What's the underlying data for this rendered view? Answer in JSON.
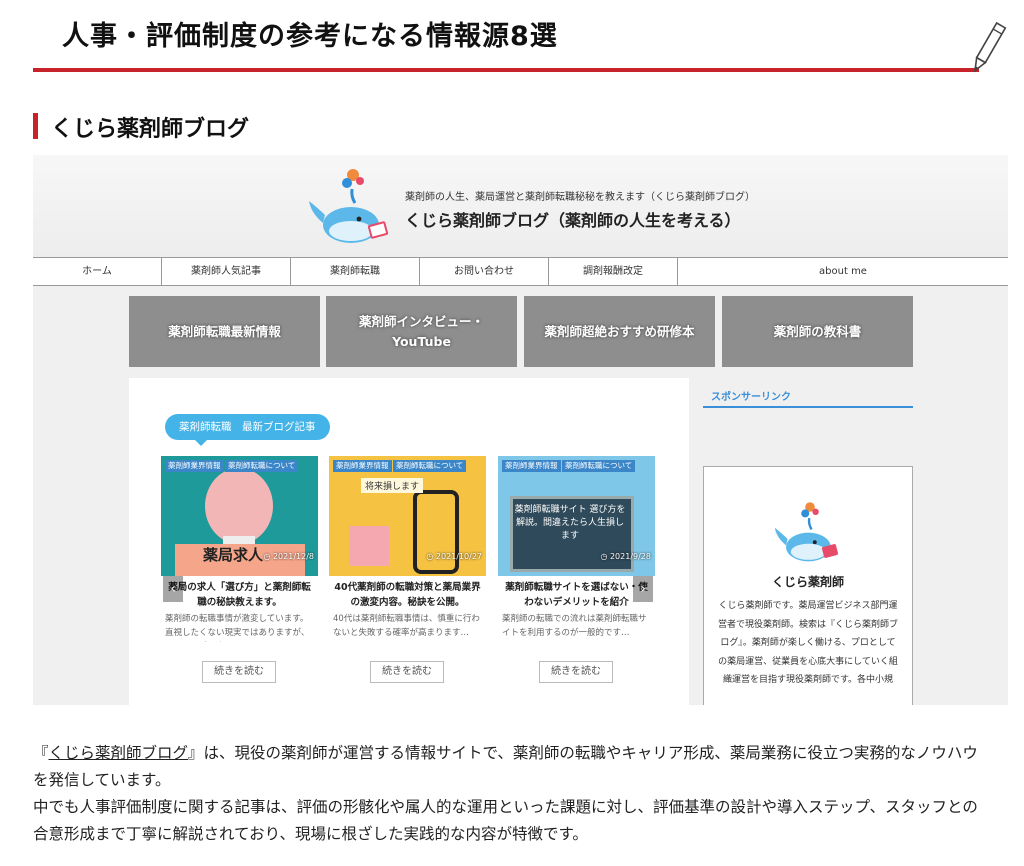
{
  "heading": "人事・評価制度の参考になる情報源8選",
  "subheading": "くじら薬剤師ブログ",
  "screenshot": {
    "tagline": "薬剤師の人生、薬局運営と薬剤師転職秘秘を教えます（くじら薬剤師ブログ）",
    "site_title": "くじら薬剤師ブログ（薬剤師の人生を考える）",
    "nav": [
      "ホーム",
      "薬剤師人気記事",
      "薬剤師転職",
      "お問い合わせ",
      "調剤報酬改定",
      "about me"
    ],
    "banners": [
      "薬剤師転職最新情報",
      "薬剤師インタビュー・YouTube",
      "薬剤師超絶おすすめ研修本",
      "薬剤師の教科書"
    ],
    "pill": "薬剤師転職　最新ブログ記事",
    "cards": [
      {
        "cat1": "薬剤師業界情報",
        "cat2": "薬剤師転職について",
        "date": "2021/12/8",
        "title": "薬局の求人「選び方」と薬剤師転職の秘訣教えます。",
        "excerpt": "薬剤師の転職事情が激変しています。直視したくない現実ではありますが、正面から受け止めて…",
        "readmore": "続きを読む"
      },
      {
        "cat1": "薬剤師業界情報",
        "cat2": "薬剤師転職について",
        "date": "2021/10/27",
        "title": "40代薬剤師の転職対策と薬局業界の激変内容。秘訣を公開。",
        "excerpt": "40代は薬剤師転職事情は、慎重に行わないと失敗する確率が高まります…",
        "readmore": "続きを読む"
      },
      {
        "cat1": "薬剤師業界情報",
        "cat2": "薬剤師転職について",
        "date": "2021/9/28",
        "title": "薬剤師転職サイトを選ばない・使わないデメリットを紹介",
        "excerpt": "薬剤師の転職での流れは薬剤師転職サイトを利用するのが一般的です…",
        "readmore": "続きを読む"
      }
    ],
    "thumb_texts": [
      "薬局求人",
      "将来損します",
      "薬剤師転職サイト 選び方を解説。間違えたら人生損します"
    ],
    "sponsor": "スポンサーリンク",
    "profile_name": "くじら薬剤師",
    "profile_bio": "くじら薬剤師です。薬局運営ビジネス部門運営者で現役薬剤師。検索は『くじら薬剤師ブログ』。薬剤師が楽しく働ける、プロとしての薬局運営、従業員を心底大事にしていく組織運営を目指す現役薬剤師です。各中小規"
  },
  "paragraph": {
    "open_quote": "『",
    "link": "くじら薬剤師ブログ",
    "line1_rest": "』は、現役の薬剤師が運営する情報サイトで、薬剤師の転職やキャリア形成、薬局業務に役立つ実務的なノウハウを発信しています。",
    "line2": "中でも人事評価制度に関する記事は、評価の形骸化や属人的な運用といった課題に対し、評価基準の設計や導入ステップ、スタッフとの合意形成まで丁寧に解説されており、現場に根ざした実践的な内容が特徴です。"
  },
  "colors": {
    "accent_red": "#c8232b",
    "accent_blue": "#44b3e8",
    "link_blue": "#3a8fd8"
  },
  "icons": [
    "pencil-icon",
    "whale-logo-icon",
    "chevron-left-icon",
    "chevron-right-icon",
    "clock-icon"
  ]
}
